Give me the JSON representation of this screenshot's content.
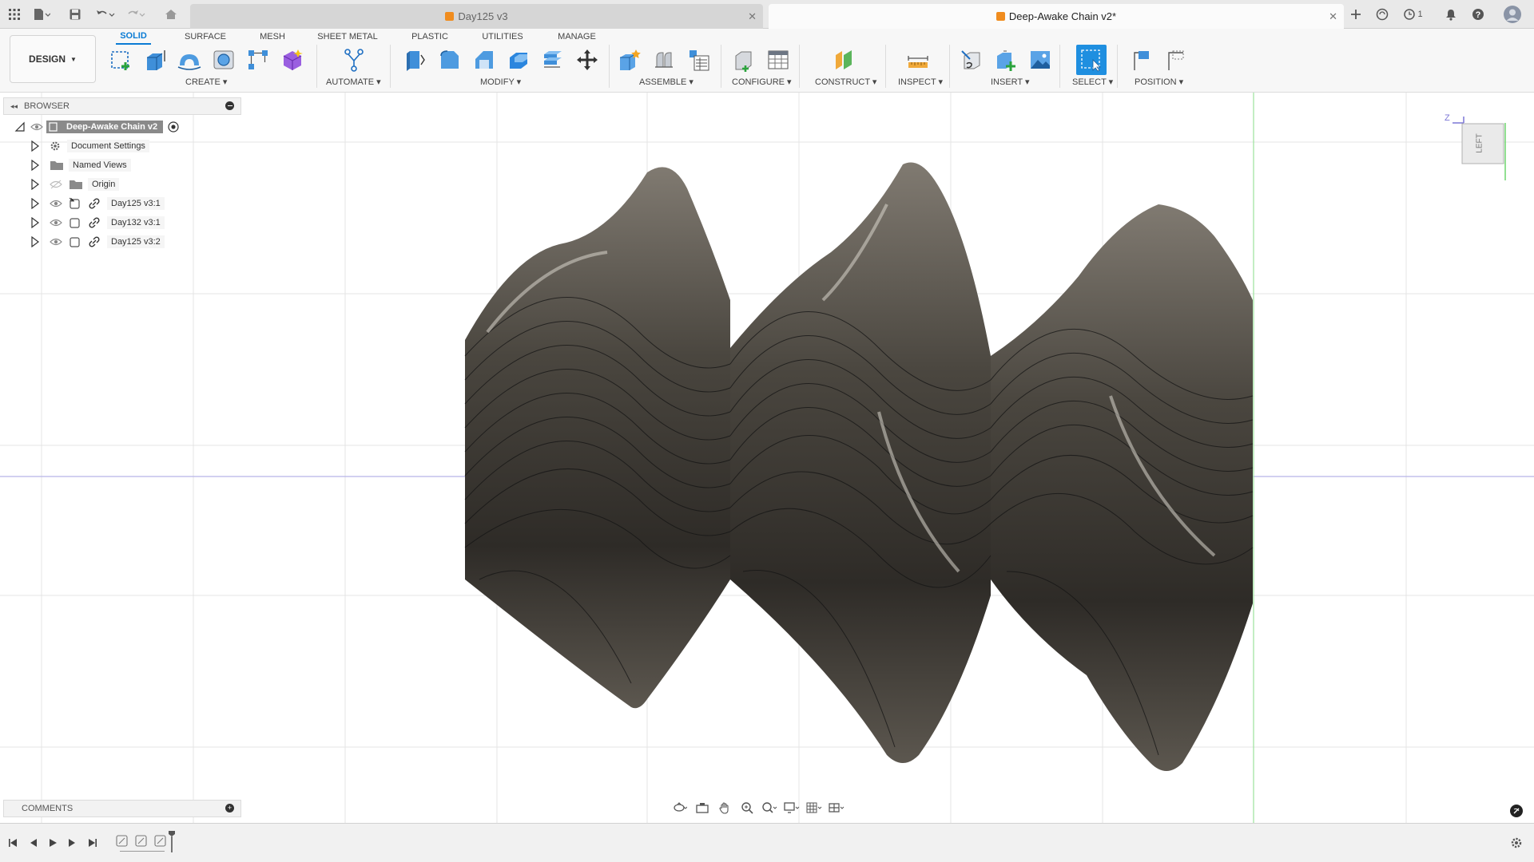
{
  "titlebar": {
    "tabs": [
      {
        "label": "Day125 v3",
        "active": false
      },
      {
        "label": "Deep-Awake Chain v2*",
        "active": true
      }
    ],
    "notification_count": "1"
  },
  "toolbar": {
    "design_label": "DESIGN",
    "workspace_tabs": [
      "SOLID",
      "SURFACE",
      "MESH",
      "SHEET METAL",
      "PLASTIC",
      "UTILITIES",
      "MANAGE"
    ],
    "active_tab": "SOLID",
    "groups": [
      "CREATE",
      "AUTOMATE",
      "MODIFY",
      "ASSEMBLE",
      "CONFIGURE",
      "CONSTRUCT",
      "INSPECT",
      "INSERT",
      "SELECT",
      "POSITION"
    ]
  },
  "browser": {
    "title": "BROWSER",
    "root": "Deep-Awake Chain v2",
    "items": [
      {
        "label": "Document Settings",
        "icon": "gear-icon"
      },
      {
        "label": "Named Views",
        "icon": "folder-icon"
      },
      {
        "label": "Origin",
        "icon": "folder-icon"
      },
      {
        "label": "Day125 v3:1",
        "icon": "component-icon"
      },
      {
        "label": "Day132 v3:1",
        "icon": "component-icon"
      },
      {
        "label": "Day125 v3:2",
        "icon": "component-icon"
      }
    ]
  },
  "viewcube": {
    "face": "LEFT",
    "axis_label": "Z"
  },
  "comments": {
    "title": "COMMENTS"
  },
  "colors": {
    "accent": "#0a7bd4",
    "model": "#555149",
    "grid": "#e6e6e6",
    "axis_x": "#b7b4e8",
    "axis_y": "#9be39b"
  }
}
